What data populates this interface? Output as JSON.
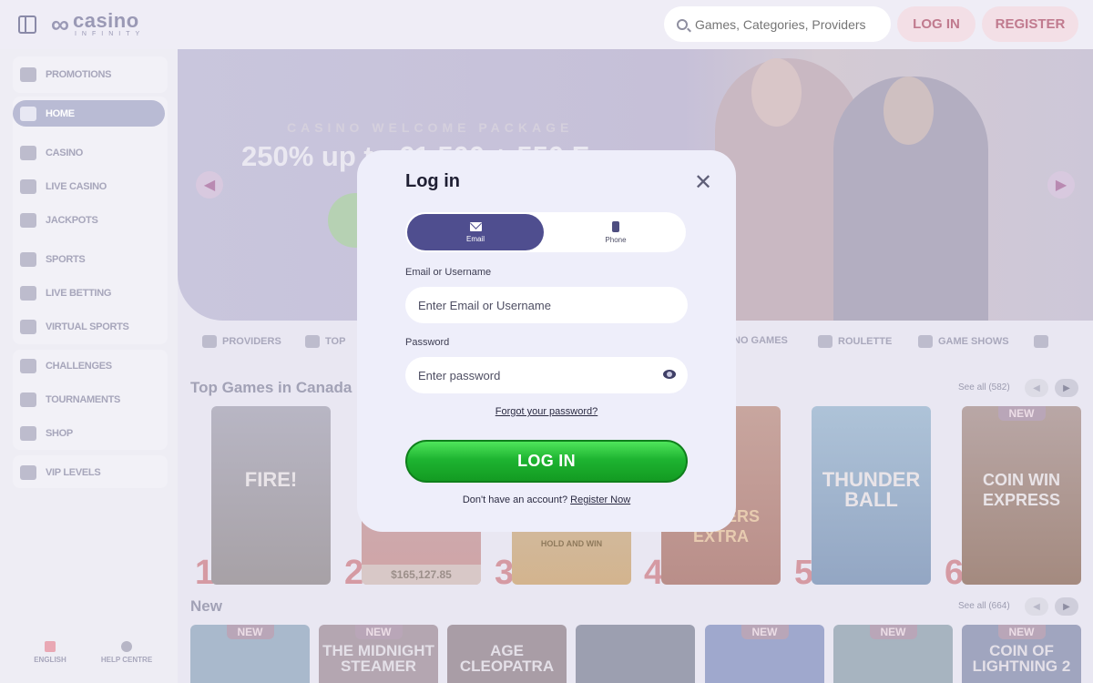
{
  "header": {
    "logo_name": "casino",
    "logo_sub": "INFINITY",
    "search_placeholder": "Games, Categories, Providers",
    "login_label": "LOG IN",
    "register_label": "REGISTER"
  },
  "sidebar": {
    "items": [
      {
        "label": "PROMOTIONS",
        "icon": "gift-icon"
      },
      {
        "label": "HOME",
        "icon": "home-icon",
        "active": true
      },
      {
        "label": "CASINO",
        "icon": "casino-icon"
      },
      {
        "label": "LIVE CASINO",
        "icon": "live-casino-icon"
      },
      {
        "label": "JACKPOTS",
        "icon": "jackpot-icon"
      },
      {
        "label": "SPORTS",
        "icon": "ball-icon"
      },
      {
        "label": "LIVE BETTING",
        "icon": "live-betting-icon"
      },
      {
        "label": "VIRTUAL SPORTS",
        "icon": "gamepad-icon"
      },
      {
        "label": "CHALLENGES",
        "icon": "challenge-icon"
      },
      {
        "label": "TOURNAMENTS",
        "icon": "trophy-icon"
      },
      {
        "label": "SHOP",
        "icon": "basket-icon"
      },
      {
        "label": "VIP LEVELS",
        "icon": "star-icon"
      }
    ],
    "footer": {
      "language": "ENGLISH",
      "help": "HELP CENTRE"
    }
  },
  "hero": {
    "eyebrow": "CASINO WELCOME PACKAGE",
    "title": "250% up to €1,500 + 550 Fr"
  },
  "categories": [
    "PROVIDERS",
    "TOP",
    "NO GAMES",
    "ROULETTE",
    "GAME SHOWS"
  ],
  "sections": {
    "top_games": {
      "title": "Top Games in Canada",
      "see_all": "See all (582)"
    },
    "new": {
      "title": "New",
      "see_all": "See all (664)"
    }
  },
  "top_games": [
    {
      "rank": "1",
      "name": "FIRE!"
    },
    {
      "rank": "2",
      "name": "",
      "jackpot": "$165,127.85"
    },
    {
      "rank": "3",
      "name": "HOLD AND WIN"
    },
    {
      "rank": "4",
      "name": "PEPPERS EXTRA"
    },
    {
      "rank": "5",
      "name": "THUNDER BALL"
    },
    {
      "rank": "6",
      "name": "COIN WIN EXPRESS",
      "badge": "NEW"
    }
  ],
  "new_games": [
    {
      "name": "",
      "badge": "NEW"
    },
    {
      "name": "THE MIDNIGHT STEAMER",
      "badge": "NEW"
    },
    {
      "name": "AGE CLEOPATRA",
      "badge": ""
    },
    {
      "name": "",
      "badge": ""
    },
    {
      "name": "",
      "badge": "NEW"
    },
    {
      "name": "",
      "badge": "NEW"
    },
    {
      "name": "COIN OF LIGHTNING 2",
      "badge": "NEW"
    }
  ],
  "modal": {
    "title": "Log in",
    "tab_email": "Email",
    "tab_phone": "Phone",
    "email_label": "Email or Username",
    "email_placeholder": "Enter Email or Username",
    "password_label": "Password",
    "password_placeholder": "Enter password",
    "forgot": "Forgot your password?",
    "login_button": "LOG IN",
    "no_account": "Don't have an account?",
    "register_link": "Register Now"
  }
}
